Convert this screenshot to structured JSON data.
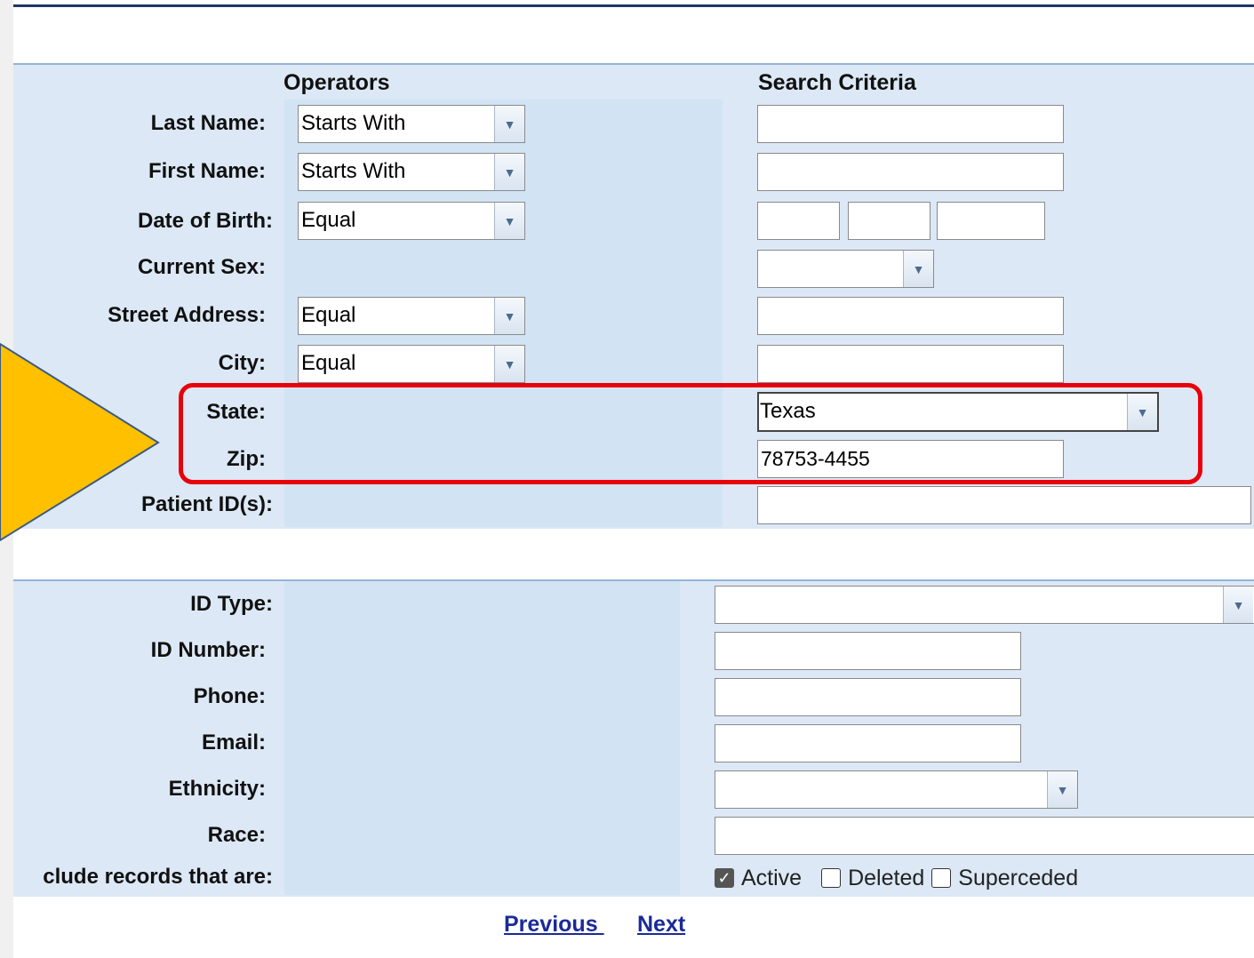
{
  "headers": {
    "operators": "Operators",
    "criteria": "Search Criteria"
  },
  "labels": {
    "last_name": "Last Name:",
    "first_name": "First Name:",
    "dob": "Date of Birth:",
    "sex": "Current Sex:",
    "street": "Street Address:",
    "city": "City:",
    "state": "State:",
    "zip": "Zip:",
    "patient_ids": "Patient ID(s):",
    "id_type": "ID Type:",
    "id_number": "ID Number:",
    "phone": "Phone:",
    "email": "Email:",
    "ethnicity": "Ethnicity:",
    "race": "Race:",
    "include": "clude records that are:"
  },
  "operators": {
    "last_name": "Starts With",
    "first_name": "Starts With",
    "dob": "Equal",
    "street": "Equal",
    "city": "Equal"
  },
  "values": {
    "last_name": "",
    "first_name": "",
    "dob_month": "",
    "dob_day": "",
    "dob_year": "",
    "sex": "",
    "street": "",
    "city": "",
    "state": "Texas",
    "zip": "78753-4455",
    "patient_ids": "",
    "id_type": "",
    "id_number": "",
    "phone": "",
    "email": "",
    "ethnicity": "",
    "race": ""
  },
  "checkboxes": [
    {
      "label": "Active",
      "checked": true
    },
    {
      "label": "Deleted",
      "checked": false
    },
    {
      "label": "Superceded",
      "checked": false
    }
  ],
  "nav": {
    "previous": "Previous ",
    "next": "Next"
  },
  "colors": {
    "highlight": "#e8000b",
    "callout": "#ffc000",
    "panel": "#dce8f5",
    "link": "#1a2a9a"
  },
  "icons": {
    "dropdown": "chevron-down-icon",
    "check": "checkmark-icon"
  }
}
